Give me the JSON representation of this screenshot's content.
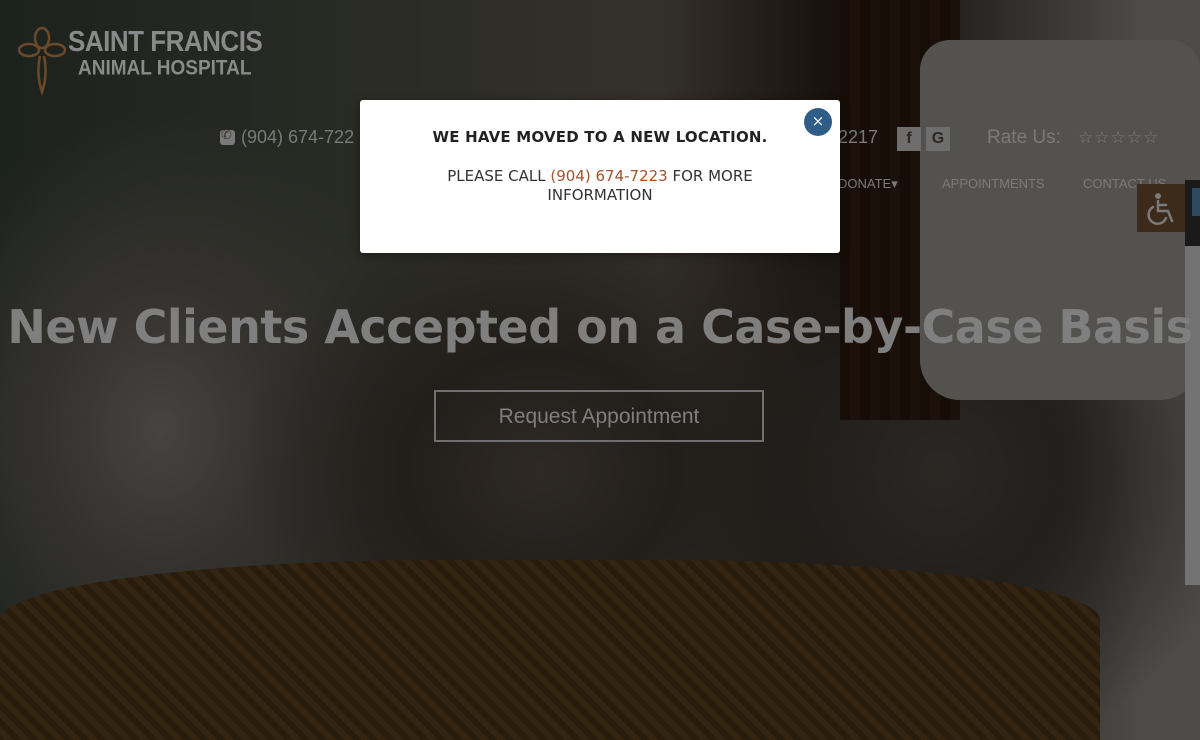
{
  "logo": {
    "line1": "SAINT FRANCIS",
    "line2": "ANIMAL HOSPITAL"
  },
  "topbar": {
    "phone_left": "(904) 674-722",
    "phone_right": "2217",
    "facebook_glyph": "f",
    "google_glyph": "G",
    "rate_label": "Rate Us:",
    "stars": "☆☆☆☆☆"
  },
  "nav": {
    "donate": "DONATE",
    "donate_caret": "▾",
    "appointments": "APPOINTMENTS",
    "contact": "CONTACT US"
  },
  "hero": {
    "title": "New Clients Accepted on a Case-by-Case Basis",
    "button": "Request Appointment"
  },
  "modal": {
    "title": "WE HAVE MOVED TO A NEW LOCATION.",
    "body_prefix": "PLEASE CALL ",
    "phone": "(904) 674-7223",
    "body_suffix": " FOR MORE INFORMATION",
    "close": "×"
  },
  "icons": {
    "phone": "phone-icon",
    "facebook": "facebook-icon",
    "google": "google-icon",
    "accessibility": "wheelchair-icon",
    "close": "close-icon"
  },
  "colors": {
    "modal_close_bg": "#2f5d87",
    "phone_link": "#a0522d",
    "accessibility_bg": "#3c2a1a"
  }
}
